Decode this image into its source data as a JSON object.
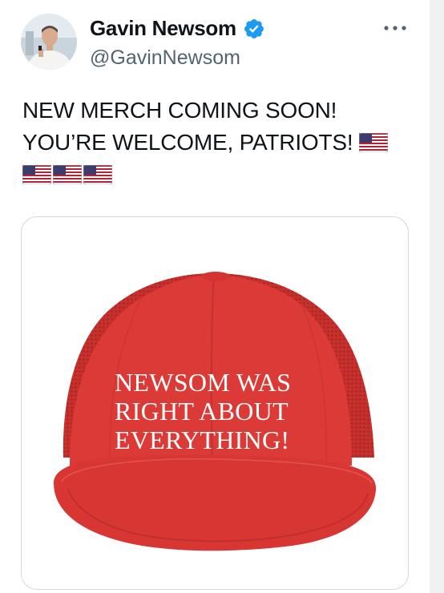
{
  "author": {
    "display_name": "Gavin Newsom",
    "handle": "@GavinNewsom",
    "verified": true,
    "avatar_icon": "profile-photo"
  },
  "more_icon": "more-horizontal-icon",
  "tweet": {
    "text_line1": "NEW MERCH COMING SOON!",
    "text_line2": "YOU’RE WELCOME, PATRIOTS!",
    "flag_emoji_count": 4
  },
  "media": {
    "type": "image",
    "hat_text": [
      "NEWSOM WAS",
      "RIGHT ABOUT",
      "EVERYTHING!"
    ],
    "hat_color": "#dc3a37"
  },
  "colors": {
    "verified_blue": "#1d9bf0",
    "handle_gray": "#536471",
    "border": "#cfd9de"
  }
}
